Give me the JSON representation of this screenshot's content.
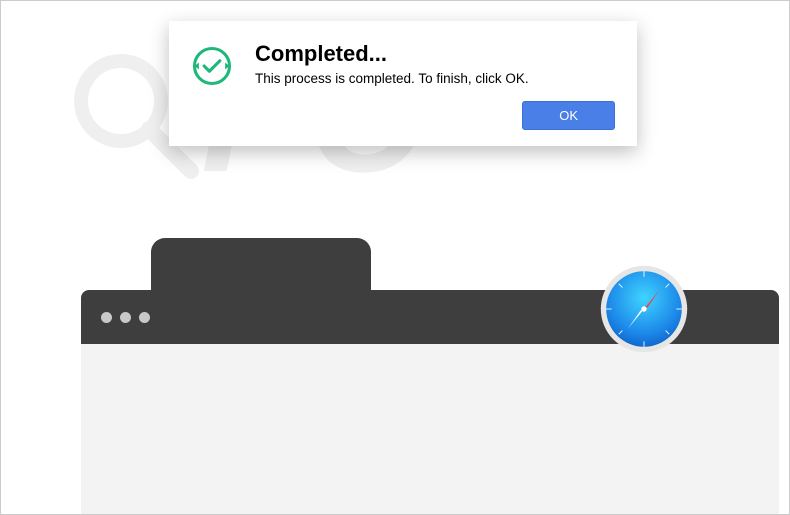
{
  "dialog": {
    "title": "Completed...",
    "message": "This process is completed. To finish, click OK.",
    "ok_label": "OK",
    "icon_name": "checkmark-circle"
  },
  "browser": {
    "icon_name": "safari-compass"
  },
  "watermark": {
    "text": "risk.com"
  },
  "colors": {
    "accent": "#4a7fe8",
    "success": "#1fb87a",
    "chrome": "#3e3e3e"
  }
}
